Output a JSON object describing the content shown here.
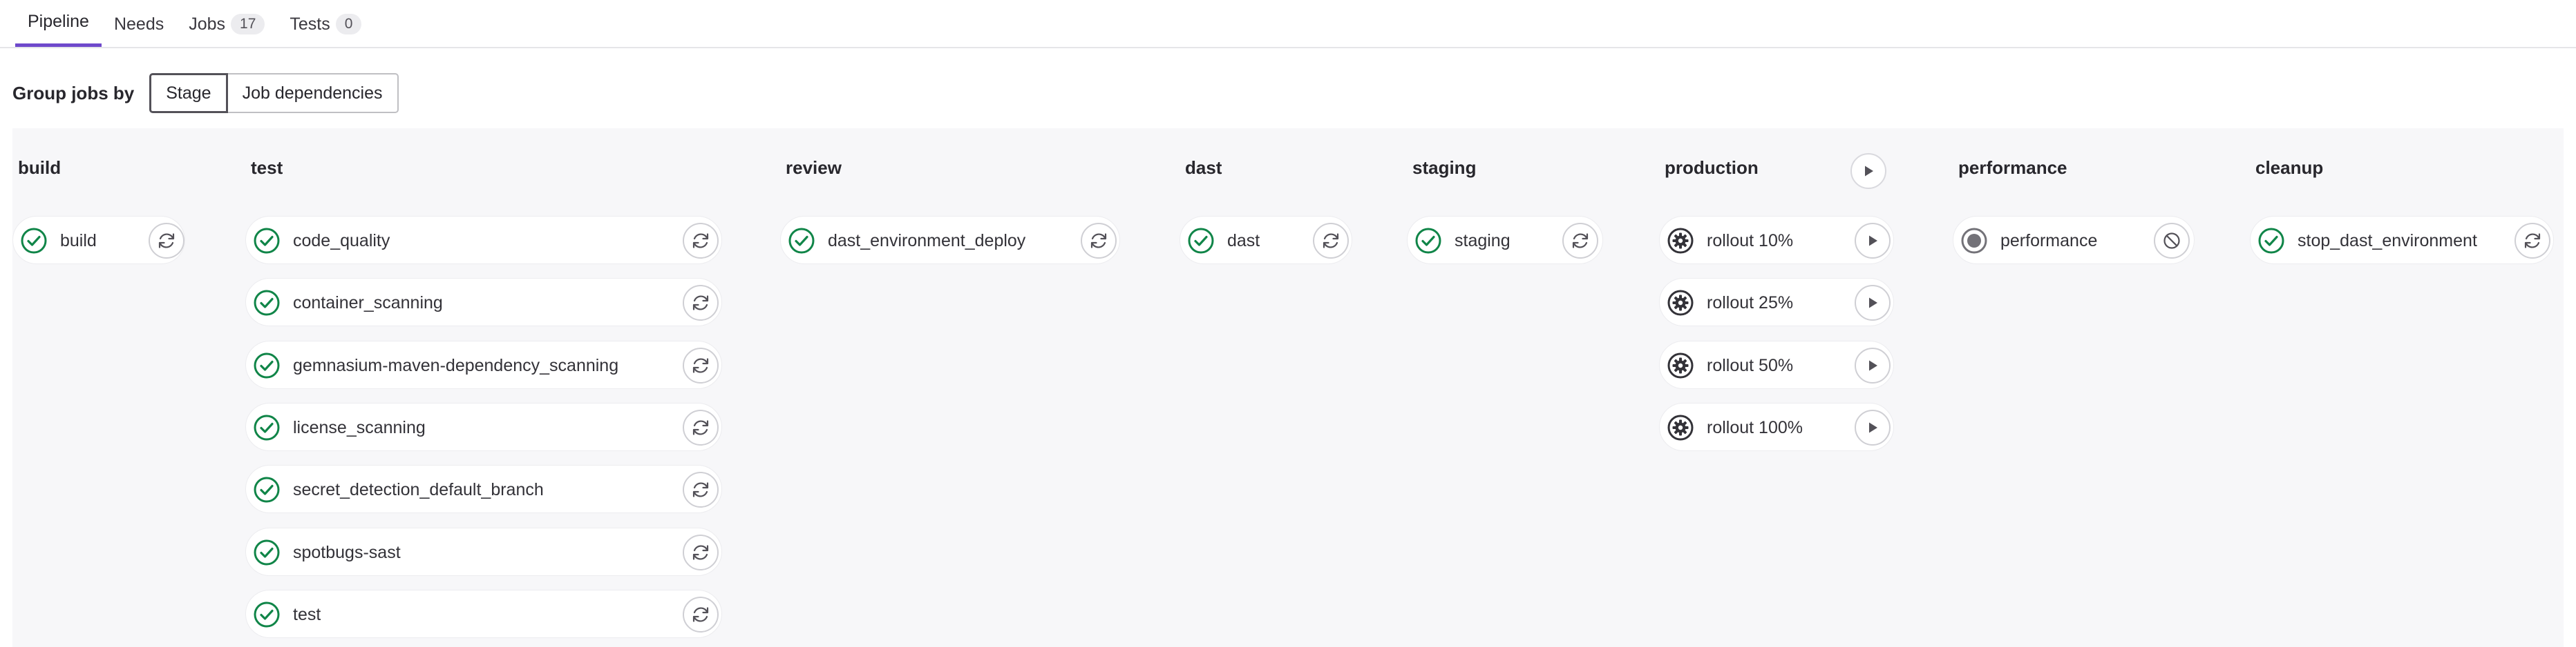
{
  "tabs": [
    {
      "label": "Pipeline",
      "count": null,
      "active": true
    },
    {
      "label": "Needs",
      "count": null,
      "active": false
    },
    {
      "label": "Jobs",
      "count": "17",
      "active": false
    },
    {
      "label": "Tests",
      "count": "0",
      "active": false
    }
  ],
  "group_by": {
    "label": "Group jobs by",
    "options": [
      "Stage",
      "Job dependencies"
    ],
    "selected": "Stage"
  },
  "colors": {
    "success": "#108548",
    "manual": "#333238",
    "skipped": "#737278",
    "active_tab": "#6e49cb"
  },
  "stages": [
    {
      "title": "build",
      "jobs": [
        {
          "name": "build",
          "status": "success-icon",
          "action": "retry-icon"
        }
      ]
    },
    {
      "title": "test",
      "jobs": [
        {
          "name": "code_quality",
          "status": "success-icon",
          "action": "retry-icon"
        },
        {
          "name": "container_scanning",
          "status": "success-icon",
          "action": "retry-icon"
        },
        {
          "name": "gemnasium-maven-dependency_scanning",
          "status": "success-icon",
          "action": "retry-icon"
        },
        {
          "name": "license_scanning",
          "status": "success-icon",
          "action": "retry-icon"
        },
        {
          "name": "secret_detection_default_branch",
          "status": "success-icon",
          "action": "retry-icon"
        },
        {
          "name": "spotbugs-sast",
          "status": "success-icon",
          "action": "retry-icon"
        },
        {
          "name": "test",
          "status": "success-icon",
          "action": "retry-icon"
        }
      ]
    },
    {
      "title": "review",
      "jobs": [
        {
          "name": "dast_environment_deploy",
          "status": "success-icon",
          "action": "retry-icon"
        }
      ]
    },
    {
      "title": "dast",
      "jobs": [
        {
          "name": "dast",
          "status": "success-icon",
          "action": "retry-icon"
        }
      ]
    },
    {
      "title": "staging",
      "jobs": [
        {
          "name": "staging",
          "status": "success-icon",
          "action": "retry-icon"
        }
      ]
    },
    {
      "title": "production",
      "stage_action": "play-icon",
      "jobs": [
        {
          "name": "rollout 10%",
          "status": "manual-gear-icon",
          "action": "play-icon"
        },
        {
          "name": "rollout 25%",
          "status": "manual-gear-icon",
          "action": "play-icon"
        },
        {
          "name": "rollout 50%",
          "status": "manual-gear-icon",
          "action": "play-icon"
        },
        {
          "name": "rollout 100%",
          "status": "manual-gear-icon",
          "action": "play-icon"
        }
      ]
    },
    {
      "title": "performance",
      "jobs": [
        {
          "name": "performance",
          "status": "skipped-icon",
          "action": "cancel-icon"
        }
      ]
    },
    {
      "title": "cleanup",
      "jobs": [
        {
          "name": "stop_dast_environment",
          "status": "success-icon",
          "action": "retry-icon"
        }
      ]
    }
  ]
}
